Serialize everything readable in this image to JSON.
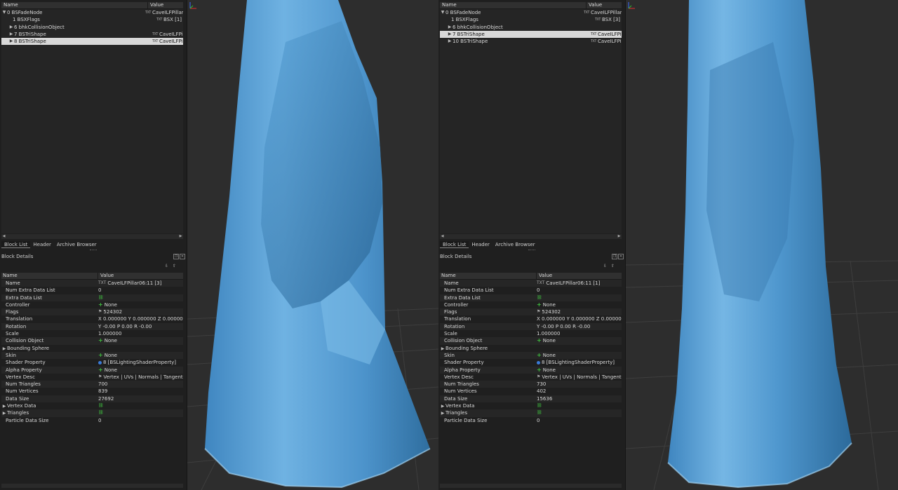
{
  "left": {
    "tree": {
      "col_name": "Name",
      "col_value": "Value",
      "rows": [
        {
          "name": "0 BSFadeNode",
          "value": "CaveILFPillar..."
        },
        {
          "name": "1 BSXFlags",
          "value": "BSX [1]"
        },
        {
          "name": "6 bhkCollisionObject",
          "value": ""
        },
        {
          "name": "7 BSTriShape",
          "value": "CaveILFPillar..."
        },
        {
          "name": "8 BSTriShape",
          "value": "CaveILFPillar..."
        }
      ]
    },
    "tabs": [
      "Block List",
      "Header",
      "Archive Browser"
    ],
    "block_details_title": "Block Details",
    "details": {
      "col_name": "Name",
      "col_value": "Value",
      "rows": [
        {
          "name": "Name",
          "value": "CaveILFPillar06:11 [3]"
        },
        {
          "name": "Num Extra Data List",
          "value": "0"
        },
        {
          "name": "Extra Data List",
          "value": ""
        },
        {
          "name": "Controller",
          "value": "None"
        },
        {
          "name": "Flags",
          "value": "524302"
        },
        {
          "name": "Translation",
          "value": "X 0.000000 Y 0.000000 Z 0.000000"
        },
        {
          "name": "Rotation",
          "value": "Y -0.00 P 0.00 R -0.00"
        },
        {
          "name": "Scale",
          "value": "1.000000"
        },
        {
          "name": "Collision Object",
          "value": "None"
        },
        {
          "name": "Bounding Sphere",
          "value": ""
        },
        {
          "name": "Skin",
          "value": "None"
        },
        {
          "name": "Shader Property",
          "value": "8 [BSLightingShaderProperty]"
        },
        {
          "name": "Alpha Property",
          "value": "None"
        },
        {
          "name": "Vertex Desc",
          "value": "Vertex | UVs | Normals | Tangents"
        },
        {
          "name": "Num Triangles",
          "value": "700"
        },
        {
          "name": "Num Vertices",
          "value": "839"
        },
        {
          "name": "Data Size",
          "value": "27692"
        },
        {
          "name": "Vertex Data",
          "value": ""
        },
        {
          "name": "Triangles",
          "value": ""
        },
        {
          "name": "Particle Data Size",
          "value": "0"
        }
      ]
    }
  },
  "right": {
    "tree": {
      "col_name": "Name",
      "col_value": "Value",
      "rows": [
        {
          "name": "0 BSFadeNode",
          "value": "CaveILFPillar..."
        },
        {
          "name": "1 BSXFlags",
          "value": "BSX [3]"
        },
        {
          "name": "6 bhkCollisionObject",
          "value": ""
        },
        {
          "name": "7 BSTriShape",
          "value": "CaveILFPillar..."
        },
        {
          "name": "10 BSTriShape",
          "value": "CaveILFPillar..."
        }
      ]
    },
    "tabs": [
      "Block List",
      "Header",
      "Archive Browser"
    ],
    "block_details_title": "Block Details",
    "details": {
      "col_name": "Name",
      "col_value": "Value",
      "rows": [
        {
          "name": "Name",
          "value": "CaveILFPillar06:11 [1]"
        },
        {
          "name": "Num Extra Data List",
          "value": "0"
        },
        {
          "name": "Extra Data List",
          "value": ""
        },
        {
          "name": "Controller",
          "value": "None"
        },
        {
          "name": "Flags",
          "value": "524302"
        },
        {
          "name": "Translation",
          "value": "X 0.000000 Y 0.000000 Z 0.000000"
        },
        {
          "name": "Rotation",
          "value": "Y -0.00 P 0.00 R -0.00"
        },
        {
          "name": "Scale",
          "value": "1.000000"
        },
        {
          "name": "Collision Object",
          "value": "None"
        },
        {
          "name": "Bounding Sphere",
          "value": ""
        },
        {
          "name": "Skin",
          "value": "None"
        },
        {
          "name": "Shader Property",
          "value": "8 [BSLightingShaderProperty]"
        },
        {
          "name": "Alpha Property",
          "value": "None"
        },
        {
          "name": "Vertex Desc",
          "value": "Vertex | UVs | Normals | Tangents"
        },
        {
          "name": "Num Triangles",
          "value": "730"
        },
        {
          "name": "Num Vertices",
          "value": "402"
        },
        {
          "name": "Data Size",
          "value": "15636"
        },
        {
          "name": "Vertex Data",
          "value": ""
        },
        {
          "name": "Triangles",
          "value": ""
        },
        {
          "name": "Particle Data Size",
          "value": "0"
        }
      ]
    }
  },
  "colors": {
    "ice": "#5a9fd0",
    "ice_light": "#9fd0f0",
    "ice_dark": "#2d6a9a",
    "link_green": "#3fbf3f",
    "selection": "#d8d8d8"
  },
  "icons": {
    "expand": "triangle-right",
    "collapse": "triangle-down",
    "add": "green-plus",
    "link": "green-link"
  }
}
